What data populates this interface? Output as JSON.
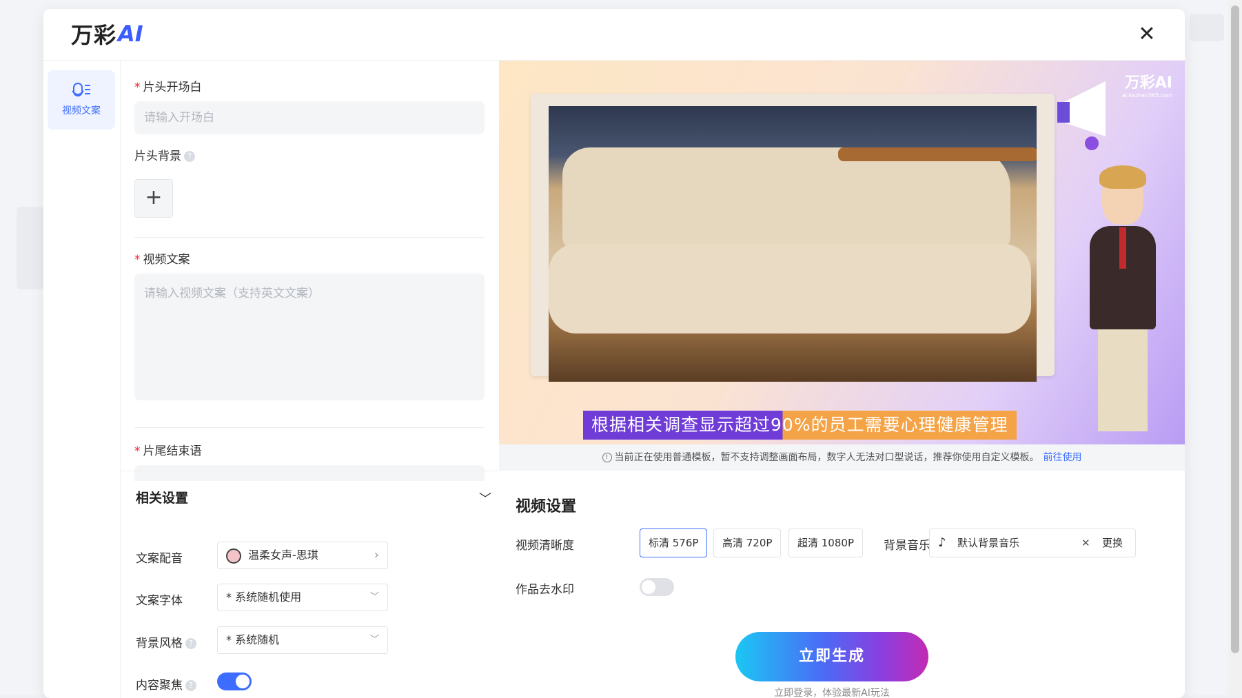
{
  "brand": {
    "logo_text": "万彩",
    "logo_ai": "AI",
    "preview_logo_text": "万彩AI",
    "preview_logo_sub": "ai.kezhan365.com"
  },
  "nav": {
    "items": [
      {
        "label": "视频文案",
        "icon": "script-microphone-icon"
      }
    ]
  },
  "form": {
    "opening": {
      "label": "片头开场白",
      "placeholder": "请输入开场白"
    },
    "background": {
      "label": "片头背景",
      "add": "+"
    },
    "script": {
      "label": "视频文案",
      "placeholder": "请输入视频文案（支持英文文案）"
    },
    "ending": {
      "label": "片尾结束语"
    }
  },
  "preview": {
    "caption": "根据相关调查显示超过90%的员工需要心理健康管理"
  },
  "notice": {
    "text": "当前正在使用普通模板，暂不支持调整画面布局，数字人无法对口型说话，推荐你使用自定义模板。",
    "link": "前往使用"
  },
  "related_settings": {
    "title": "相关设置",
    "voice": {
      "label": "文案配音",
      "value": "温柔女声-思琪"
    },
    "font": {
      "label": "文案字体",
      "value": "* 系统随机使用"
    },
    "bg_style": {
      "label": "背景风格",
      "value": "* 系统随机"
    },
    "focus": {
      "label": "内容聚焦",
      "on": true
    }
  },
  "video_settings": {
    "title": "视频设置",
    "resolution_label": "视频清晰度",
    "resolutions": [
      {
        "label": "标清 576P",
        "active": true
      },
      {
        "label": "高清 720P",
        "active": false
      },
      {
        "label": "超清 1080P",
        "active": false
      }
    ],
    "music_label": "背景音乐",
    "music_value": "默认背景音乐",
    "music_change": "更换",
    "watermark_label": "作品去水印",
    "watermark_on": false,
    "generate": "立即生成",
    "generate_sub": "立即登录，体验最新AI玩法"
  },
  "colors": {
    "accent": "#3d6dff",
    "required": "#f5222d"
  }
}
